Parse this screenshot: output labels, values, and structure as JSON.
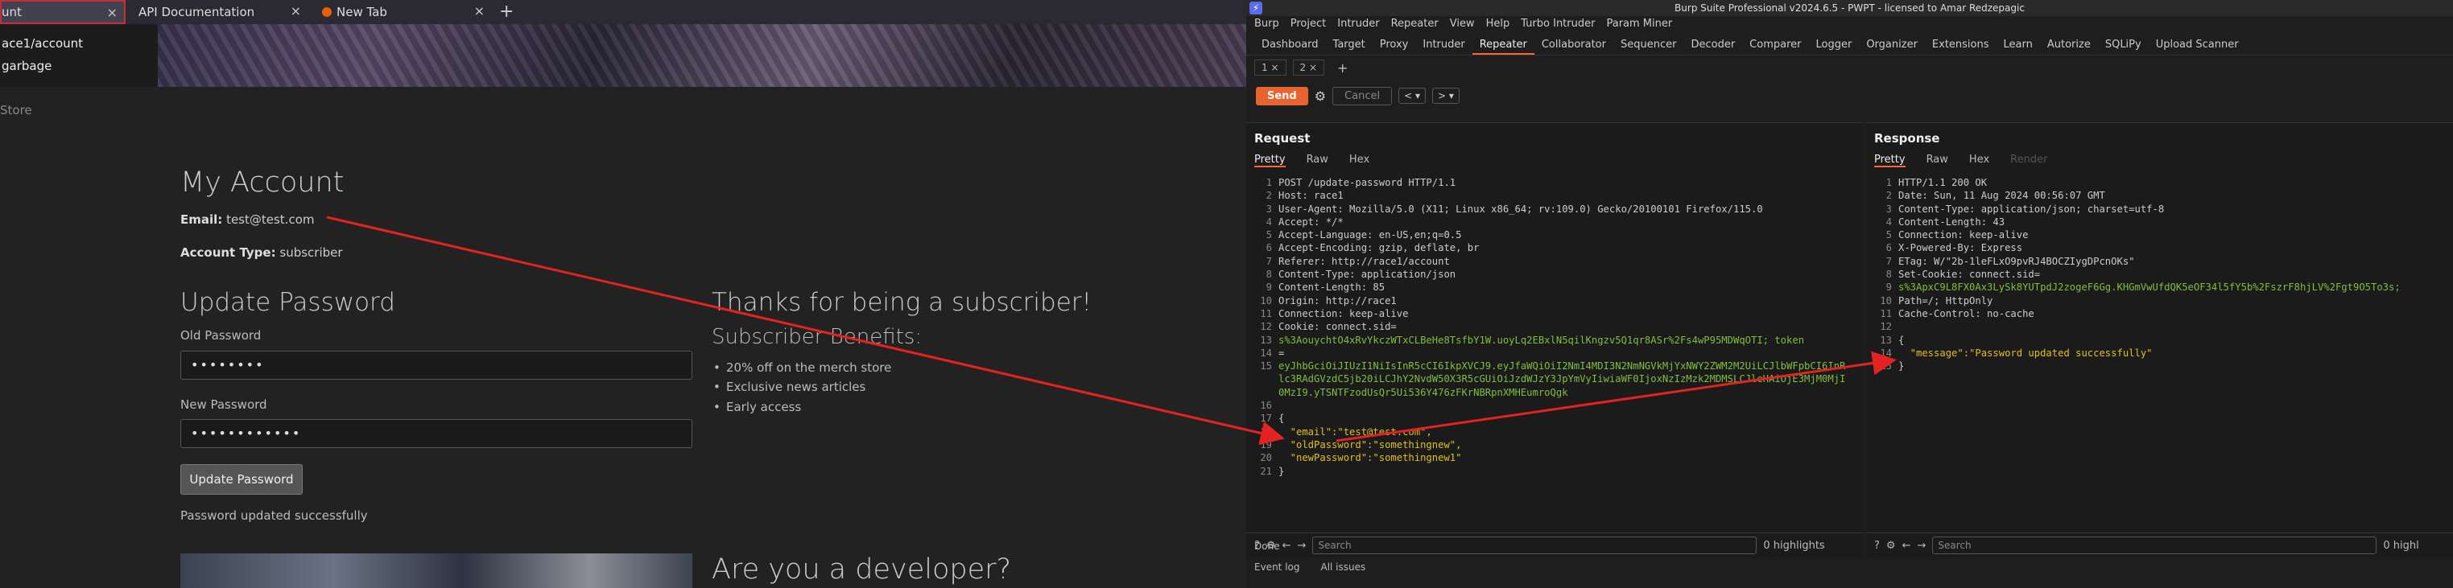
{
  "browser": {
    "tabs": [
      {
        "label": "unt",
        "active": true
      },
      {
        "label": "API Documentation"
      },
      {
        "label": "New Tab"
      }
    ],
    "dropdown": [
      "ace1/account",
      "garbage"
    ],
    "breadcrumb": "Store"
  },
  "page": {
    "title": "My Account",
    "email_label": "Email:",
    "email_value": "test@test.com",
    "account_type_label": "Account Type:",
    "account_type_value": "subscriber",
    "update_title": "Update Password",
    "old_label": "Old Password",
    "old_value": "••••••••",
    "new_label": "New Password",
    "new_value": "••••••••••••",
    "button": "Update Password",
    "success": "Password updated successfully",
    "thanks": "Thanks for being a subscriber!",
    "benefits_title": "Subscriber Benefits:",
    "benefits": [
      "20% off on the merch store",
      "Exclusive news articles",
      "Early access"
    ],
    "dev_title": "Are you a developer?"
  },
  "burp": {
    "title": "Burp Suite Professional v2024.6.5 - PWPT - licensed to Amar Redzepagic",
    "menu": [
      "Burp",
      "Project",
      "Intruder",
      "Repeater",
      "View",
      "Help",
      "Turbo Intruder",
      "Param Miner"
    ],
    "tabs": [
      "Dashboard",
      "Target",
      "Proxy",
      "Intruder",
      "Repeater",
      "Collaborator",
      "Sequencer",
      "Decoder",
      "Comparer",
      "Logger",
      "Organizer",
      "Extensions",
      "Learn",
      "Autorize",
      "SQLiPy",
      "Upload Scanner"
    ],
    "active_tab": "Repeater",
    "subtabs": [
      "1 ×",
      "2 ×"
    ],
    "send": "Send",
    "cancel": "Cancel",
    "request_title": "Request",
    "response_title": "Response",
    "req_tabs": [
      "Pretty",
      "Raw",
      "Hex"
    ],
    "res_tabs": [
      "Pretty",
      "Raw",
      "Hex",
      "Render"
    ],
    "request_lines": [
      "POST /update-password HTTP/1.1",
      "Host: race1",
      "User-Agent: Mozilla/5.0 (X11; Linux x86_64; rv:109.0) Gecko/20100101 Firefox/115.0",
      "Accept: */*",
      "Accept-Language: en-US,en;q=0.5",
      "Accept-Encoding: gzip, deflate, br",
      "Referer: http://race1/account",
      "Content-Type: application/json",
      "Content-Length: 85",
      "Origin: http://race1",
      "Connection: keep-alive",
      "Cookie: connect.sid=",
      "s%3AouychtO4xRvYkczWTxCLBeHe8TsfbY1W.uoyLq2EBxlN5qilKngzv5Q1qr8ASr%2Fs4wP95MDWqOTI; token",
      "=",
      "eyJhbGciOiJIUzI1NiIsInR5cCI6IkpXVCJ9.eyJfaWQiOiI2NmI4MDI3N2NmNGVkMjYxNWY2ZWM2M2UiLCJlbWFpbCI6InRlc3RAdGVzdC5jb20iLCJhY2NvdW50X3R5cGUiOiJzdWJzY3JpYmVyIiwiaWF0IjoxNzIzMzk2MDMSLCJleHAiOjE3MjM0MjI0MzI9.yTSNTFzodUsQr5Ui536Y476zFKrNBRpnXMHEumroQgk",
      "",
      "{",
      "  \"email\":\"test@test.com\",",
      "  \"oldPassword\":\"somethingnew\",",
      "  \"newPassword\":\"somethingnew1\"",
      "}"
    ],
    "response_lines": [
      "HTTP/1.1 200 OK",
      "Date: Sun, 11 Aug 2024 00:56:07 GMT",
      "Content-Type: application/json; charset=utf-8",
      "Content-Length: 43",
      "Connection: keep-alive",
      "X-Powered-By: Express",
      "ETag: W/\"2b-1leFLxO9pvRJ4BOCZIygDPcnOKs\"",
      "Set-Cookie: connect.sid=",
      "s%3ApxC9L8FX0Ax3LySk8YUTpdJ2zogeF6Gg.KHGmVwUfdQK5eOF34l5fY5b%2FszrF8hjLV%2Fgt9O5To3s;",
      "Path=/; HttpOnly",
      "Cache-Control: no-cache",
      "",
      "{",
      "  \"message\":\"Password updated successfully\"",
      "}"
    ],
    "search_placeholder": "Search",
    "highlights": "0 highlights",
    "highlights_short": "0 highl",
    "done": "Done",
    "bottom_tabs": [
      "Event log",
      "All issues"
    ]
  }
}
